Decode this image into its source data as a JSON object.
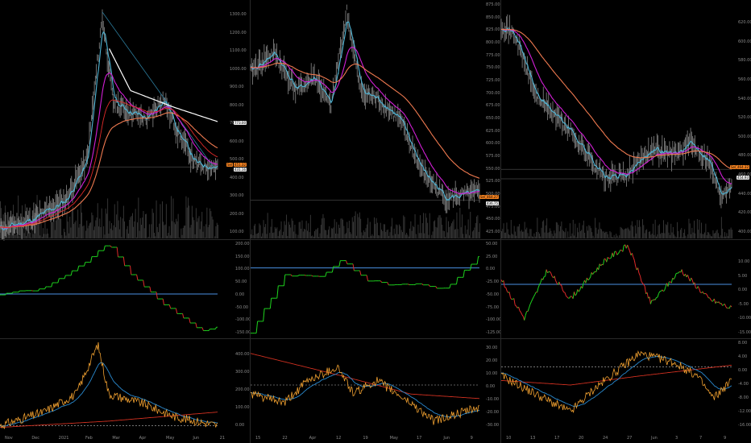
{
  "colors": {
    "price": "#8a8a8a",
    "cyan": "#4fb6d6",
    "magenta": "#d21fd6",
    "red": "#e02a2a",
    "orange": "#f07a50",
    "white": "#ffffff",
    "green": "#1ed41e",
    "blue_line": "#4a90e2",
    "osc": "#f0a030",
    "slow": "#d03020",
    "fast": "#2a8ad0",
    "tag_orange": "#f08020",
    "tag_white": "#e8e8e8"
  },
  "panels": [
    {
      "id": "p1",
      "currency": "USD",
      "price_axis": [
        "1300.00",
        "1200.00",
        "1100.00",
        "1000.00",
        "900.00",
        "800.00",
        "700.00",
        "600.00",
        "500.00",
        "400.00",
        "300.00",
        "200.00",
        "100.00"
      ],
      "osc_axis": [
        "200.00",
        "150.00",
        "100.00",
        "50.00",
        "0.00",
        "-50.00",
        "-100.00",
        "-150.00"
      ],
      "low_axis": [
        "400.00",
        "300.00",
        "200.00",
        "100.00",
        "0.00"
      ],
      "x_labels": [
        "Nov",
        "Dec",
        "2021",
        "Feb",
        "Mar",
        "Apr",
        "May",
        "Jun",
        "21"
      ],
      "tags": [
        {
          "text": "Sel",
          "color": "#f08020"
        },
        {
          "text": "451.32",
          "color": "#f08020"
        },
        {
          "text": "431.16",
          "color": "#e8e8e8"
        },
        {
          "text": "773.00",
          "color": "#e8e8e8"
        }
      ]
    },
    {
      "id": "p2",
      "currency": "USD",
      "price_axis": [
        "875.00",
        "850.00",
        "825.00",
        "800.00",
        "775.00",
        "750.00",
        "725.00",
        "700.00",
        "675.00",
        "650.00",
        "625.00",
        "600.00",
        "575.00",
        "550.00",
        "525.00",
        "500.00",
        "475.00",
        "450.00",
        "425.00"
      ],
      "osc_axis": [
        "50.00",
        "25.00",
        "0.00",
        "-25.00",
        "-50.00",
        "-75.00",
        "-100.00",
        "-125.00"
      ],
      "low_axis": [
        "30.00",
        "20.00",
        "10.00",
        "0.00",
        "-10.00",
        "-20.00",
        "-30.00"
      ],
      "x_labels": [
        "15",
        "22",
        "Apr",
        "12",
        "19",
        "May",
        "17",
        "Jun",
        "9"
      ],
      "tags": [
        {
          "text": "Sel",
          "color": "#f08020"
        },
        {
          "text": "464.27",
          "color": "#f08020"
        },
        {
          "text": "436.75",
          "color": "#e8e8e8"
        }
      ]
    },
    {
      "id": "p3",
      "currency": "USD",
      "price_axis": [
        "620.00",
        "600.00",
        "580.00",
        "560.00",
        "540.00",
        "520.00",
        "500.00",
        "480.00",
        "460.00",
        "440.00",
        "420.00",
        "400.00"
      ],
      "osc_axis": [
        "10.00",
        "5.00",
        "0.00",
        "-5.00",
        "-10.00",
        "-15.00"
      ],
      "low_axis": [
        "8.00",
        "4.00",
        "0.00",
        "-4.00",
        "-8.00",
        "-12.00",
        "-16.00"
      ],
      "x_labels": [
        "10",
        "13",
        "17",
        "20",
        "24",
        "27",
        "Jun",
        "3",
        "7",
        "9"
      ],
      "tags": [
        {
          "text": "Sel",
          "color": "#f08020"
        },
        {
          "text": "464.32",
          "color": "#f08020"
        },
        {
          "text": "454.93",
          "color": "#e8e8e8"
        }
      ]
    }
  ]
}
